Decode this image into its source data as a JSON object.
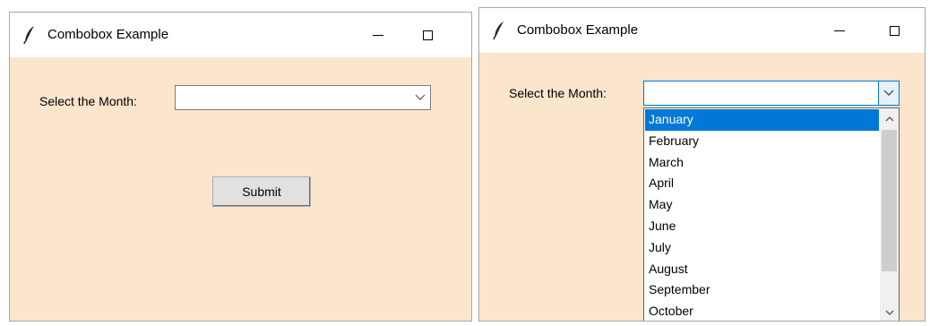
{
  "windows": [
    {
      "title": "Combobox Example",
      "label": "Select the Month:",
      "combo_value": "",
      "submit_label": "Submit"
    },
    {
      "title": "Combobox Example",
      "label": "Select the Month:",
      "combo_value": "",
      "dropdown_items": [
        "January",
        "February",
        "March",
        "April",
        "May",
        "June",
        "July",
        "August",
        "September",
        "October"
      ],
      "selected_item": "January"
    }
  ],
  "colors": {
    "window_bg": "#fce5cd",
    "titlebar_bg": "#ffffff",
    "selection": "#0078d7"
  },
  "icons": {
    "app_icon": "feather-icon",
    "minimize": "minimize-icon",
    "maximize": "maximize-icon",
    "dropdown_arrow": "chevron-down-icon",
    "scroll_up": "chevron-up-icon",
    "scroll_down": "chevron-down-icon"
  }
}
